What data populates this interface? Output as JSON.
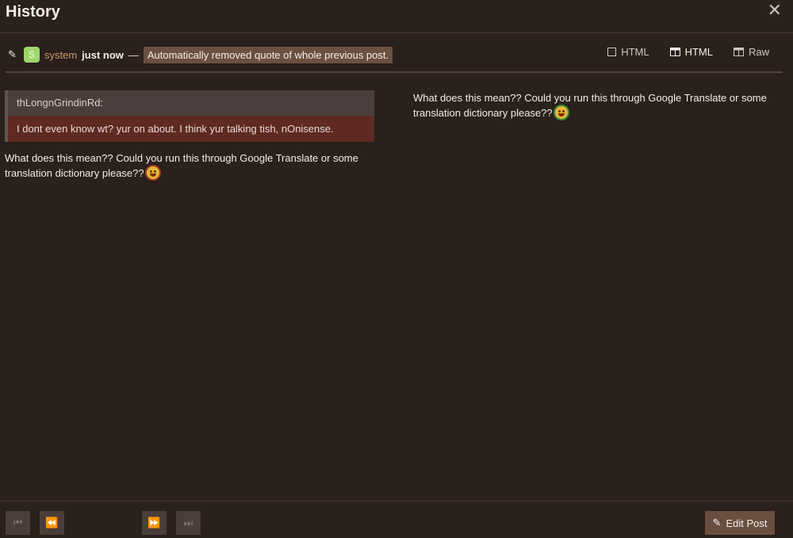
{
  "modal": {
    "title": "History",
    "close_icon": "close-icon"
  },
  "revision": {
    "user_initial": "S",
    "username": "system",
    "when": "just now",
    "dash": "—",
    "reason": "Automatically removed quote of whole previous post.",
    "avatar_color": "#9fd66a"
  },
  "view_tabs": [
    {
      "label": "HTML",
      "icon": "square-icon"
    },
    {
      "label": "HTML",
      "icon": "side-by-side-icon",
      "active": true
    },
    {
      "label": "Raw",
      "icon": "side-by-side-markdown-icon"
    }
  ],
  "previous": {
    "quote_author": "thLongnGrindinRd:",
    "quote_text": "I dont even know wt? yur on about. I think yur talking tish, nOnisense.",
    "text": "What does this mean?? Could you run this through Google Translate or some translation dictionary please??"
  },
  "current": {
    "text": "What does this mean?? Could you run this through Google Translate or some translation dictionary please??"
  },
  "footer": {
    "first_icon": "first-revision-icon",
    "prev_icon": "previous-revision-icon",
    "next_icon": "next-revision-icon",
    "last_icon": "last-revision-icon",
    "edit_label": "Edit Post"
  },
  "colors": {
    "background": "#2a201c",
    "deleted": "#5e2a22",
    "accent": "#6a4e40"
  }
}
